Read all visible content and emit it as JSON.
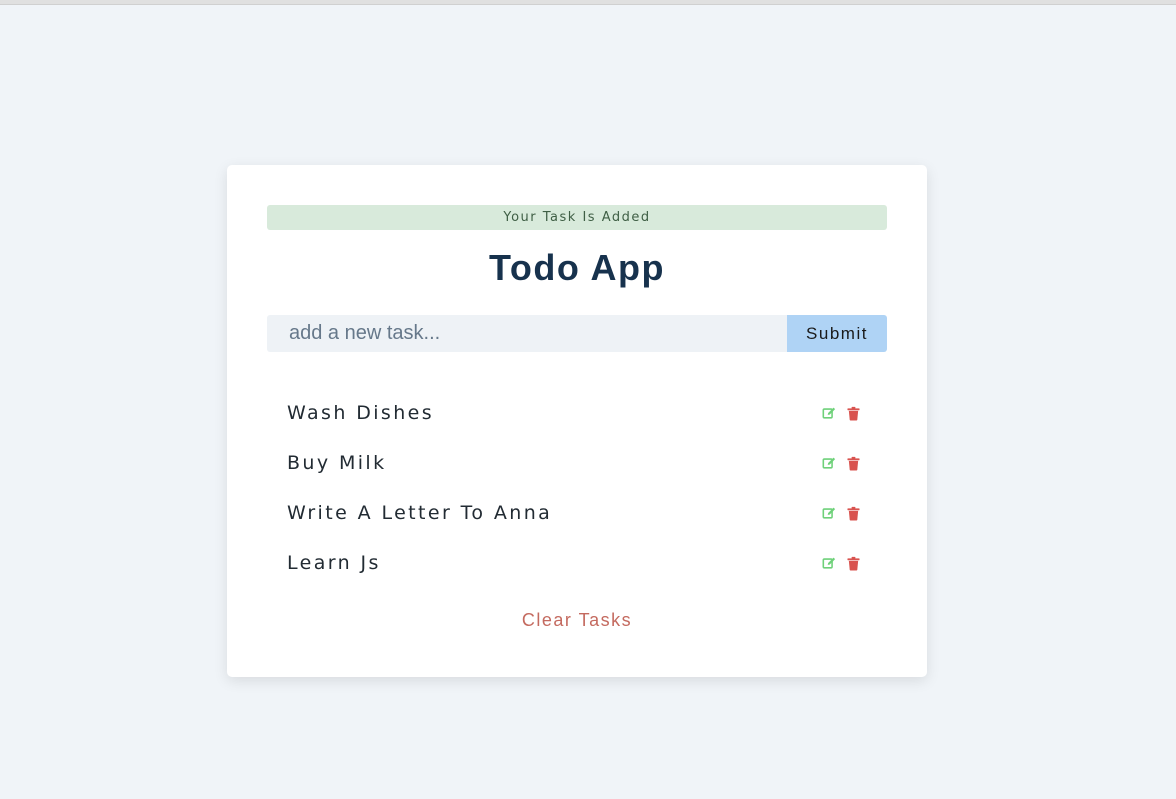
{
  "alert": {
    "message": "Your Task Is Added"
  },
  "app": {
    "title": "Todo App"
  },
  "form": {
    "input_value": "",
    "input_placeholder": "add a new task...",
    "submit_label": "Submit"
  },
  "tasks": [
    {
      "label": "Wash Dishes",
      "edit_icon": "edit-icon",
      "delete_icon": "trash-icon"
    },
    {
      "label": "Buy Milk",
      "edit_icon": "edit-icon",
      "delete_icon": "trash-icon"
    },
    {
      "label": "Write A Letter To Anna",
      "edit_icon": "edit-icon",
      "delete_icon": "trash-icon"
    },
    {
      "label": "Learn Js",
      "edit_icon": "edit-icon",
      "delete_icon": "trash-icon"
    }
  ],
  "footer": {
    "clear_label": "Clear Tasks"
  },
  "colors": {
    "background": "#f0f4f8",
    "card": "#ffffff",
    "alert_bg": "#d8eadb",
    "alert_text": "#3f5f45",
    "title": "#17324d",
    "input_bg": "#eef2f6",
    "submit_bg": "#afd3f5",
    "edit_icon": "#6fd17a",
    "delete_icon": "#d9534f",
    "clear_text": "#c46a5f"
  }
}
